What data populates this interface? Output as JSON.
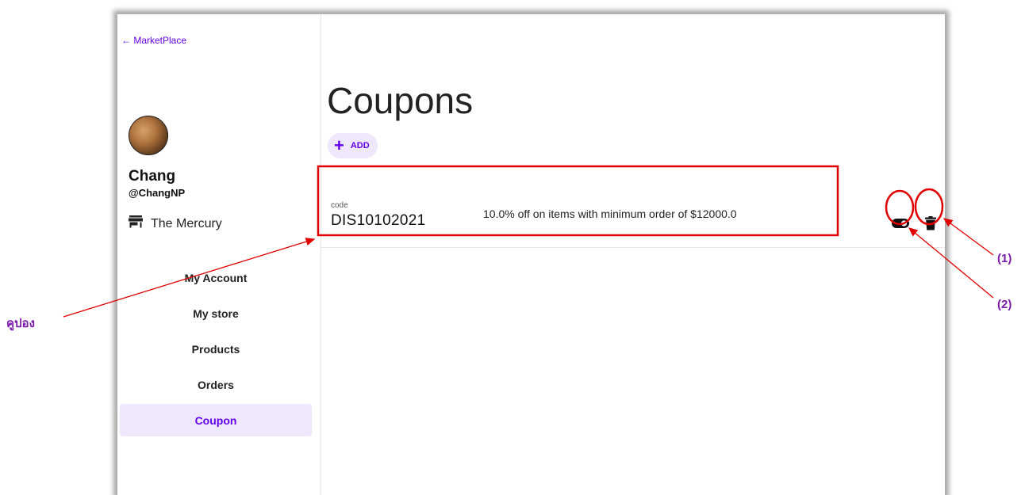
{
  "sidebar": {
    "back_label": "← MarketPlace",
    "user_name": "Chang",
    "user_handle": "@ChangNP",
    "store_name": "The Mercury",
    "nav": [
      {
        "label": "My Account",
        "active": false
      },
      {
        "label": "My store",
        "active": false
      },
      {
        "label": "Products",
        "active": false
      },
      {
        "label": "Orders",
        "active": false
      },
      {
        "label": "Coupon",
        "active": true
      }
    ]
  },
  "main": {
    "title": "Coupons",
    "add_label": "ADD",
    "coupon": {
      "code_label": "code",
      "code": "DIS10102021",
      "description": "10.0% off on items with minimum order of $12000.0"
    }
  },
  "annotations": {
    "coupon_label": "คูปอง",
    "delete_label": "(1)",
    "toggle_label": "(2)"
  },
  "colors": {
    "accent": "#6200ee",
    "active_bg": "#efe7fb",
    "annotation": "#e00000",
    "annotation_text": "#7a1aa8"
  }
}
